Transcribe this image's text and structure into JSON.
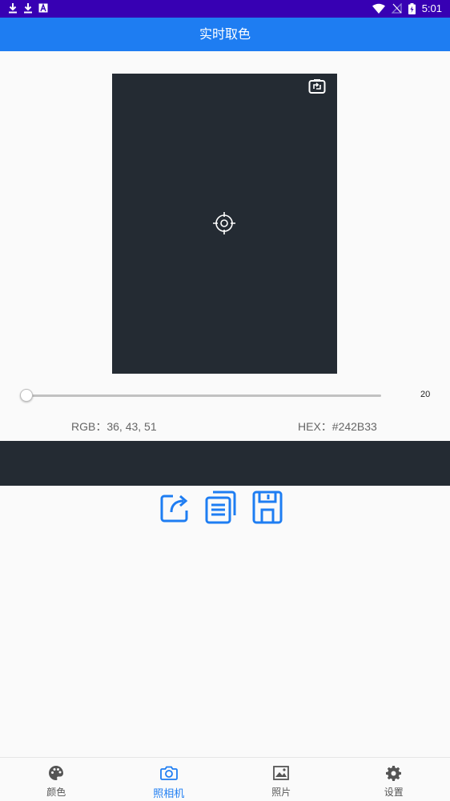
{
  "status_bar": {
    "time": "5:01",
    "left_icons": [
      "download-icon",
      "download-icon",
      "font-icon"
    ],
    "right_icons": [
      "wifi-icon",
      "no-sim-icon",
      "battery-icon"
    ]
  },
  "app_bar": {
    "title": "实时取色"
  },
  "preview": {
    "color": "#242B33",
    "icons": [
      "switch-camera-icon",
      "crosshair-icon"
    ]
  },
  "slider": {
    "value": "20",
    "level": 0
  },
  "readout": {
    "rgb": "RGB：36, 43, 51",
    "hex": "HEX：#242B33"
  },
  "swatch_color": "#242B33",
  "actions": [
    "share-icon",
    "copy-icon",
    "save-icon"
  ],
  "accent_color": "#1E7DF2",
  "bottom_nav": [
    {
      "label": "颜色",
      "icon": "palette-icon",
      "active": false
    },
    {
      "label": "照相机",
      "icon": "camera-icon",
      "active": true
    },
    {
      "label": "照片",
      "icon": "image-icon",
      "active": false
    },
    {
      "label": "设置",
      "icon": "gear-icon",
      "active": false
    }
  ]
}
